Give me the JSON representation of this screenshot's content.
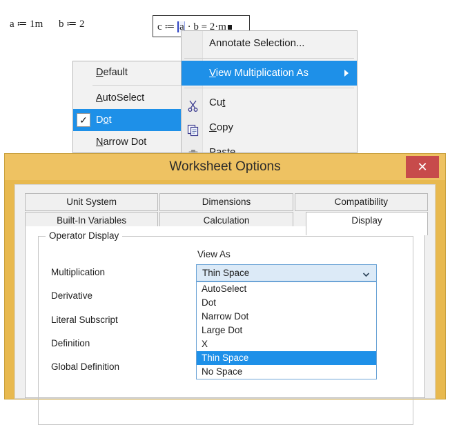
{
  "worksheet": {
    "expr_a": "a ≔ 1m",
    "expr_b": "b ≔ 2",
    "expr_c_prefix": "c ≔ ",
    "expr_c_selected": "a",
    "expr_c_rest": " · b = 2·m"
  },
  "context_menu": {
    "items": [
      {
        "label": "Annotate Selection...",
        "mnemonic": "",
        "icon": "",
        "highlight": false,
        "submenu_arrow": false
      },
      {
        "separator": true
      },
      {
        "label": "View Multiplication As",
        "mnemonic": "V",
        "icon": "",
        "highlight": true,
        "submenu_arrow": true
      },
      {
        "separator": true
      },
      {
        "label": "Cut",
        "mnemonic": "t",
        "icon": "scissors-icon",
        "highlight": false,
        "submenu_arrow": false
      },
      {
        "label": "Copy",
        "mnemonic": "C",
        "icon": "copy-icon",
        "highlight": false,
        "submenu_arrow": false
      },
      {
        "label": "Paste",
        "mnemonic": "P",
        "icon": "clipboard-icon",
        "highlight": false,
        "submenu_arrow": false
      }
    ]
  },
  "submenu": {
    "items": [
      {
        "label": "Default",
        "mnemonic": "D",
        "checked": false,
        "highlight": false
      },
      {
        "separator": true
      },
      {
        "label": "AutoSelect",
        "mnemonic": "A",
        "checked": false,
        "highlight": false
      },
      {
        "label": "Dot",
        "mnemonic": "o",
        "checked": true,
        "highlight": true
      },
      {
        "label": "Narrow Dot",
        "mnemonic": "N",
        "checked": false,
        "highlight": false
      }
    ]
  },
  "dialog": {
    "title": "Worksheet Options",
    "close_label": "✕",
    "tabs_row1": [
      "Unit System",
      "Dimensions",
      "Compatibility"
    ],
    "tabs_row2": [
      "Built-In Variables",
      "Calculation",
      "Display"
    ],
    "active_tab": "Display",
    "groupbox_label": "Operator Display",
    "view_as_label": "View As",
    "operator_labels": [
      "Multiplication",
      "Derivative",
      "Literal Subscript",
      "Definition",
      "Global Definition"
    ],
    "combo": {
      "value": "Thin Space",
      "options": [
        "AutoSelect",
        "Dot",
        "Narrow Dot",
        "Large Dot",
        "X",
        "Thin Space",
        "No Space"
      ],
      "selected_index": 5
    }
  },
  "colors": {
    "menu_highlight": "#1e90e8",
    "dialog_frame": "#eec262",
    "close_button": "#c74b4b",
    "combo_border": "#6ba3d6",
    "combo_bg": "#dceaf7"
  }
}
